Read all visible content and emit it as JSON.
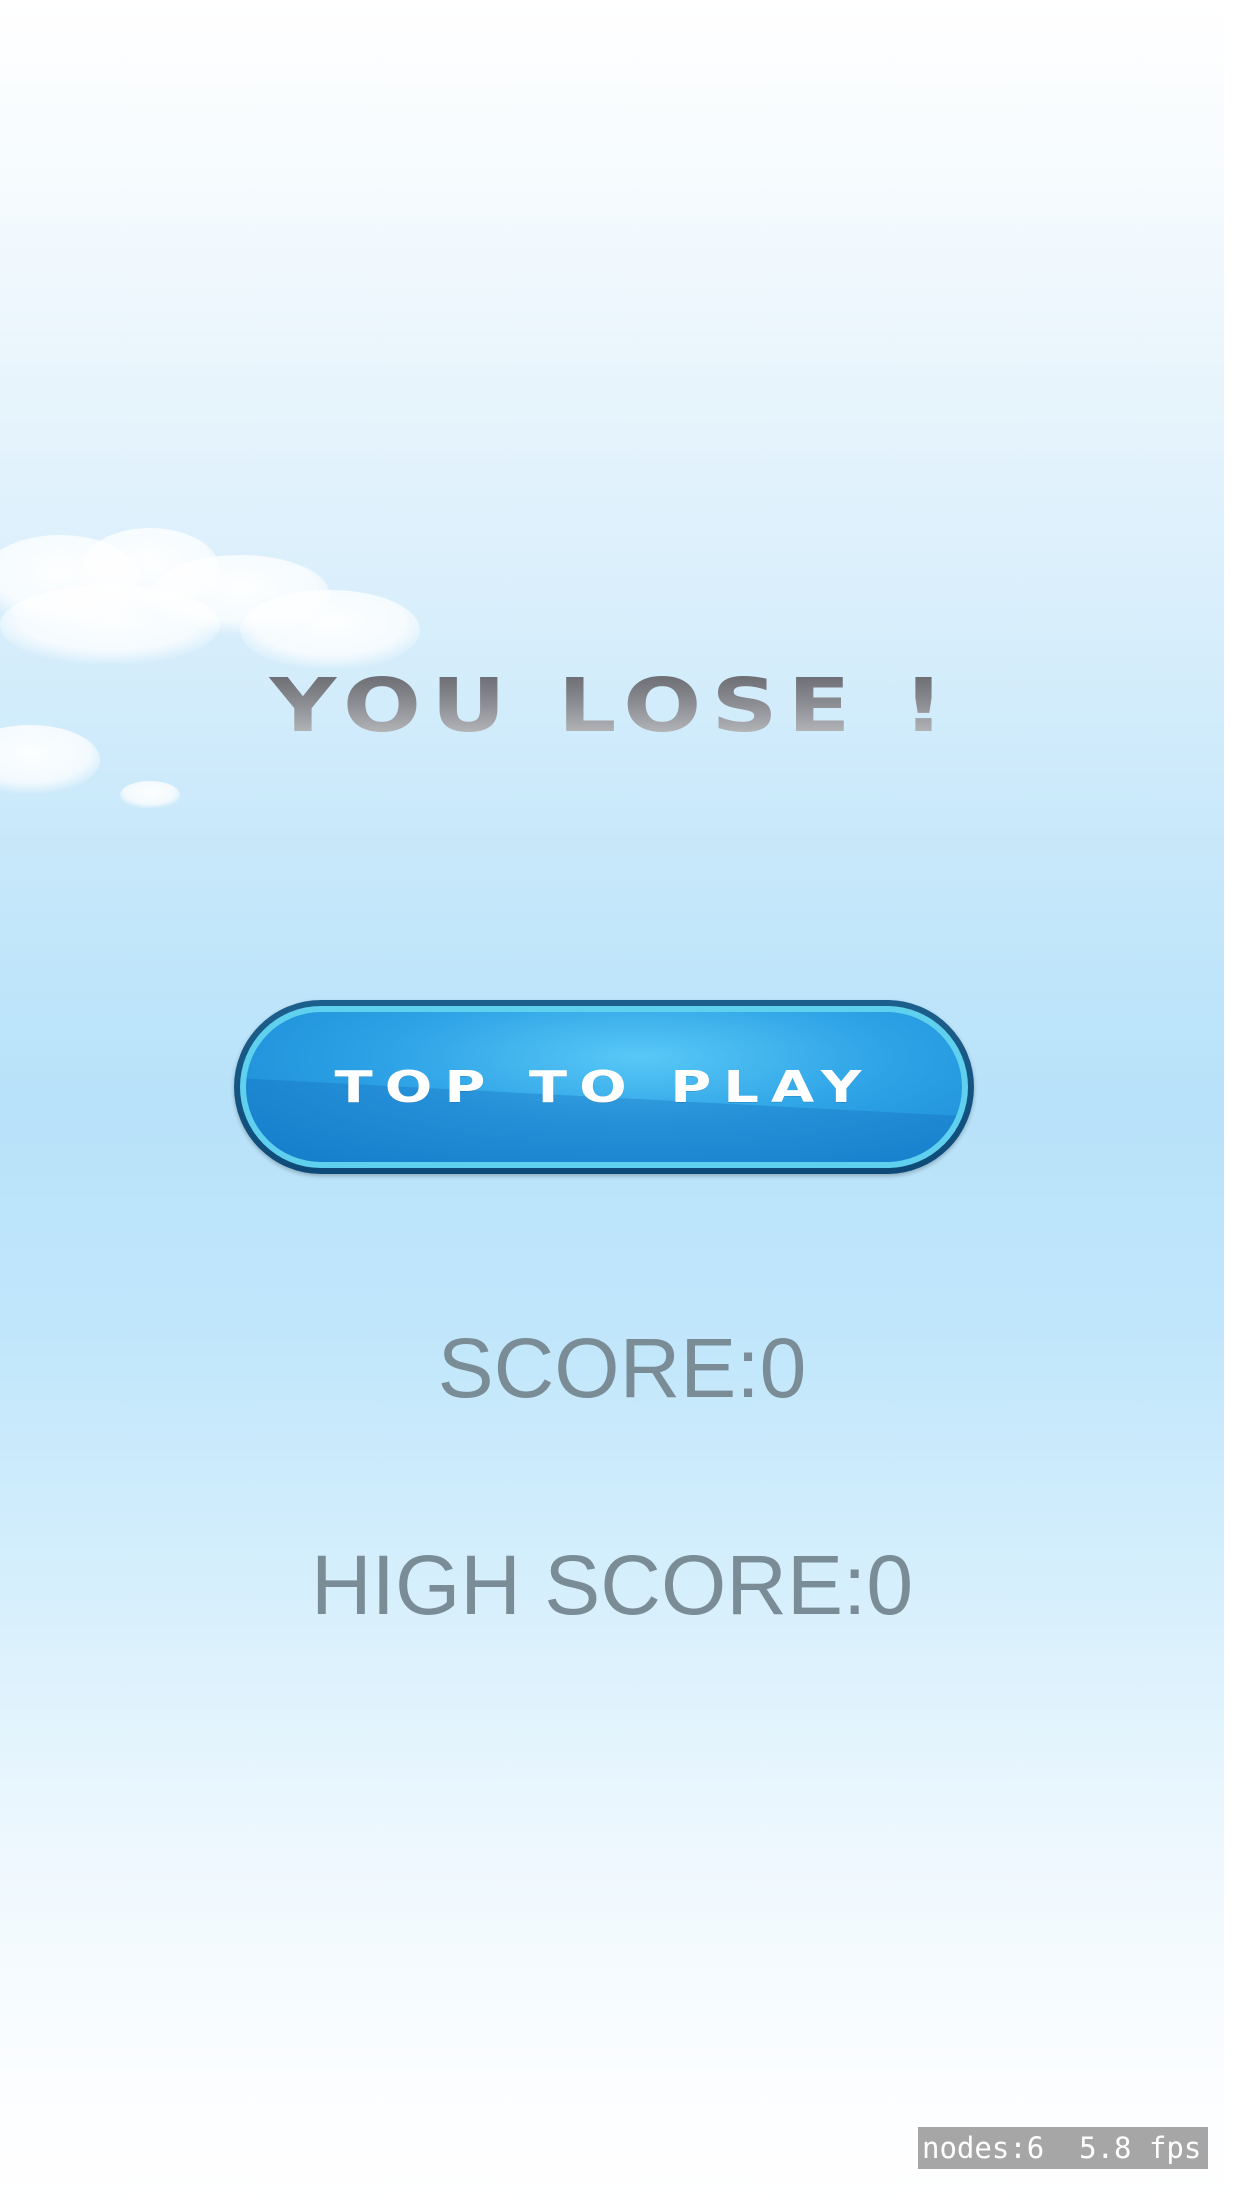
{
  "game": {
    "title": "YOU LOSE !",
    "play_button_label": "TOP TO PLAY",
    "score_text": "SCORE:0",
    "high_score_text": "HIGH SCORE:0"
  },
  "debug_overlay": {
    "text": "nodes:6  5.8 fps"
  },
  "colors": {
    "sky_top": "#ffffff",
    "sky_mid": "#b8e2fa",
    "button_fill": "#2ea3e6",
    "button_border": "#0d4a78",
    "score_text": "#7a8c96",
    "title_text": "#8a8a8a"
  },
  "icons": {
    "clouds": "cloud-cluster"
  }
}
